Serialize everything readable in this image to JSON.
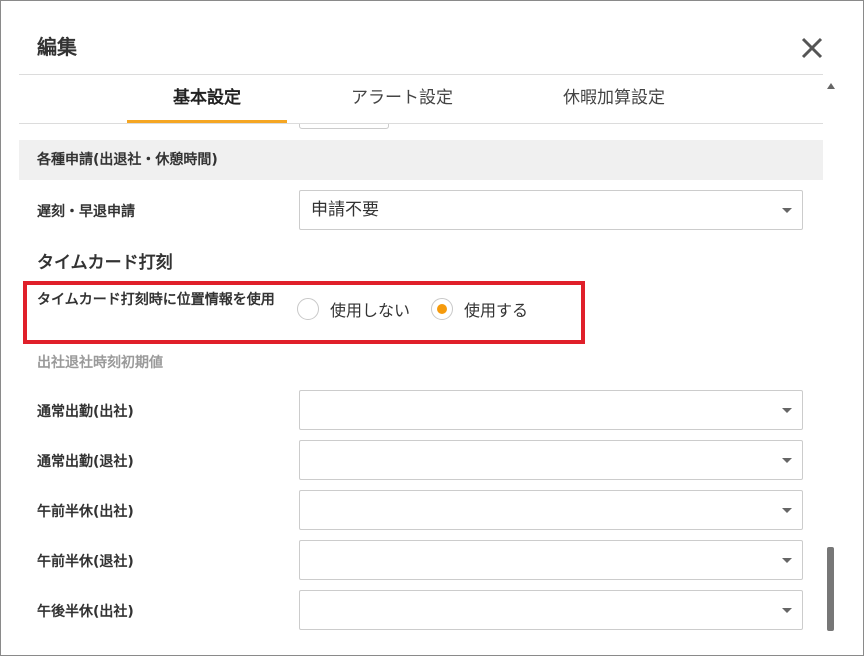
{
  "dialog": {
    "title": "編集",
    "close_icon": "close-icon"
  },
  "tabs": [
    {
      "label": "基本設定",
      "active": true
    },
    {
      "label": "アラート設定",
      "active": false
    },
    {
      "label": "休暇加算設定",
      "active": false
    }
  ],
  "section": {
    "title": "各種申請(出退社・休憩時間)",
    "late_early": {
      "label": "遅刻・早退申請",
      "value": "申請不要"
    }
  },
  "timecard": {
    "title": "タイムカード打刻",
    "location": {
      "label": "タイムカード打刻時に位置情報を使用",
      "options": [
        {
          "label": "使用しない",
          "checked": false
        },
        {
          "label": "使用する",
          "checked": true
        }
      ]
    }
  },
  "defaults": {
    "title": "出社退社時刻初期値",
    "rows": [
      {
        "label": "通常出勤(出社)",
        "value": ""
      },
      {
        "label": "通常出勤(退社)",
        "value": ""
      },
      {
        "label": "午前半休(出社)",
        "value": ""
      },
      {
        "label": "午前半休(退社)",
        "value": ""
      },
      {
        "label": "午後半休(出社)",
        "value": ""
      }
    ]
  },
  "colors": {
    "accent": "#f5a623",
    "radio_checked": "#f59a0c",
    "highlight": "#e0202a",
    "section_bg": "#f0f0f0"
  }
}
